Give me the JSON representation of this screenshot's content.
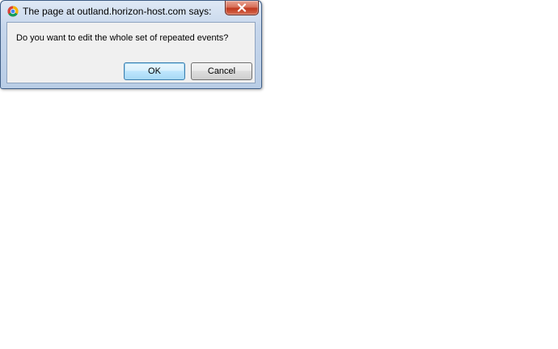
{
  "dialog": {
    "title": "The page at outland.horizon-host.com says:",
    "title_icon": "chrome-logo-icon",
    "close_icon": "close-icon",
    "message": "Do you want to edit the whole set of repeated events?",
    "ok_label": "OK",
    "cancel_label": "Cancel",
    "colors": {
      "frame": "#b9cde6",
      "close_button": "#c0391f",
      "content_bg": "#f0f0f0",
      "focused_button": "#bee6fd"
    }
  }
}
